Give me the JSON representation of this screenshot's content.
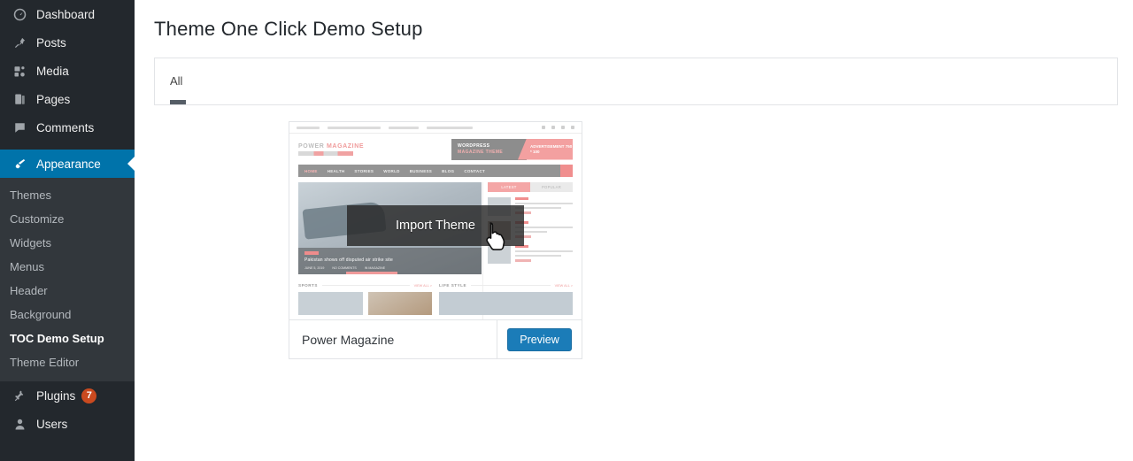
{
  "sidebar": {
    "items": [
      {
        "label": "Dashboard",
        "icon": "dashboard-icon",
        "current": false
      },
      {
        "label": "Posts",
        "icon": "pin-icon",
        "current": false
      },
      {
        "label": "Media",
        "icon": "media-icon",
        "current": false
      },
      {
        "label": "Pages",
        "icon": "pages-icon",
        "current": false
      },
      {
        "label": "Comments",
        "icon": "comments-icon",
        "current": false
      },
      {
        "label": "Appearance",
        "icon": "appearance-brush-icon",
        "current": true
      },
      {
        "label": "Plugins",
        "icon": "plugins-icon",
        "current": false,
        "badge": "7"
      },
      {
        "label": "Users",
        "icon": "users-icon",
        "current": false
      }
    ],
    "submenu": [
      {
        "label": "Themes",
        "active": false
      },
      {
        "label": "Customize",
        "active": false
      },
      {
        "label": "Widgets",
        "active": false
      },
      {
        "label": "Menus",
        "active": false
      },
      {
        "label": "Header",
        "active": false
      },
      {
        "label": "Background",
        "active": false
      },
      {
        "label": "TOC Demo Setup",
        "active": true
      },
      {
        "label": "Theme Editor",
        "active": false
      }
    ],
    "colors": {
      "background": "#23282d",
      "submenu_background": "#32373c",
      "current_highlight": "#0073aa",
      "badge": "#ca4a1f"
    }
  },
  "page": {
    "title": "Theme One Click Demo Setup"
  },
  "tabs": {
    "items": [
      {
        "label": "All",
        "selected": true
      }
    ]
  },
  "theme_card": {
    "name": "Power Magazine",
    "preview_label": "Preview",
    "overlay_label": "Import Theme",
    "preview_button_color": "#1b7cb8",
    "cursor": "hand-pointer-icon",
    "screenshot": {
      "logo": "POWER",
      "logo_accent": "MAGAZINE",
      "nav": [
        "HOME",
        "HEALTH",
        "STORIES",
        "WORLD",
        "BUSINESS",
        "BLOG",
        "CONTACT"
      ],
      "ad_title": "WORDPRESS",
      "ad_subtitle": "MAGAZINE THEME",
      "ad_label": "ADVERTISEMENT",
      "ad_size": "750 * 100",
      "hero_title": "Pakistan shows off disputed air strike site",
      "hero_meta": [
        "JUNE 5, 2019",
        "NO COMMENTS",
        "IN MAGAZINE"
      ],
      "sidebar_tabs": [
        "LATEST",
        "POPULAR"
      ],
      "sections": [
        {
          "title": "SPORTS",
          "more": "VIEW ALL >"
        },
        {
          "title": "LIFE STYLE",
          "more": "VIEW ALL >"
        }
      ]
    }
  }
}
